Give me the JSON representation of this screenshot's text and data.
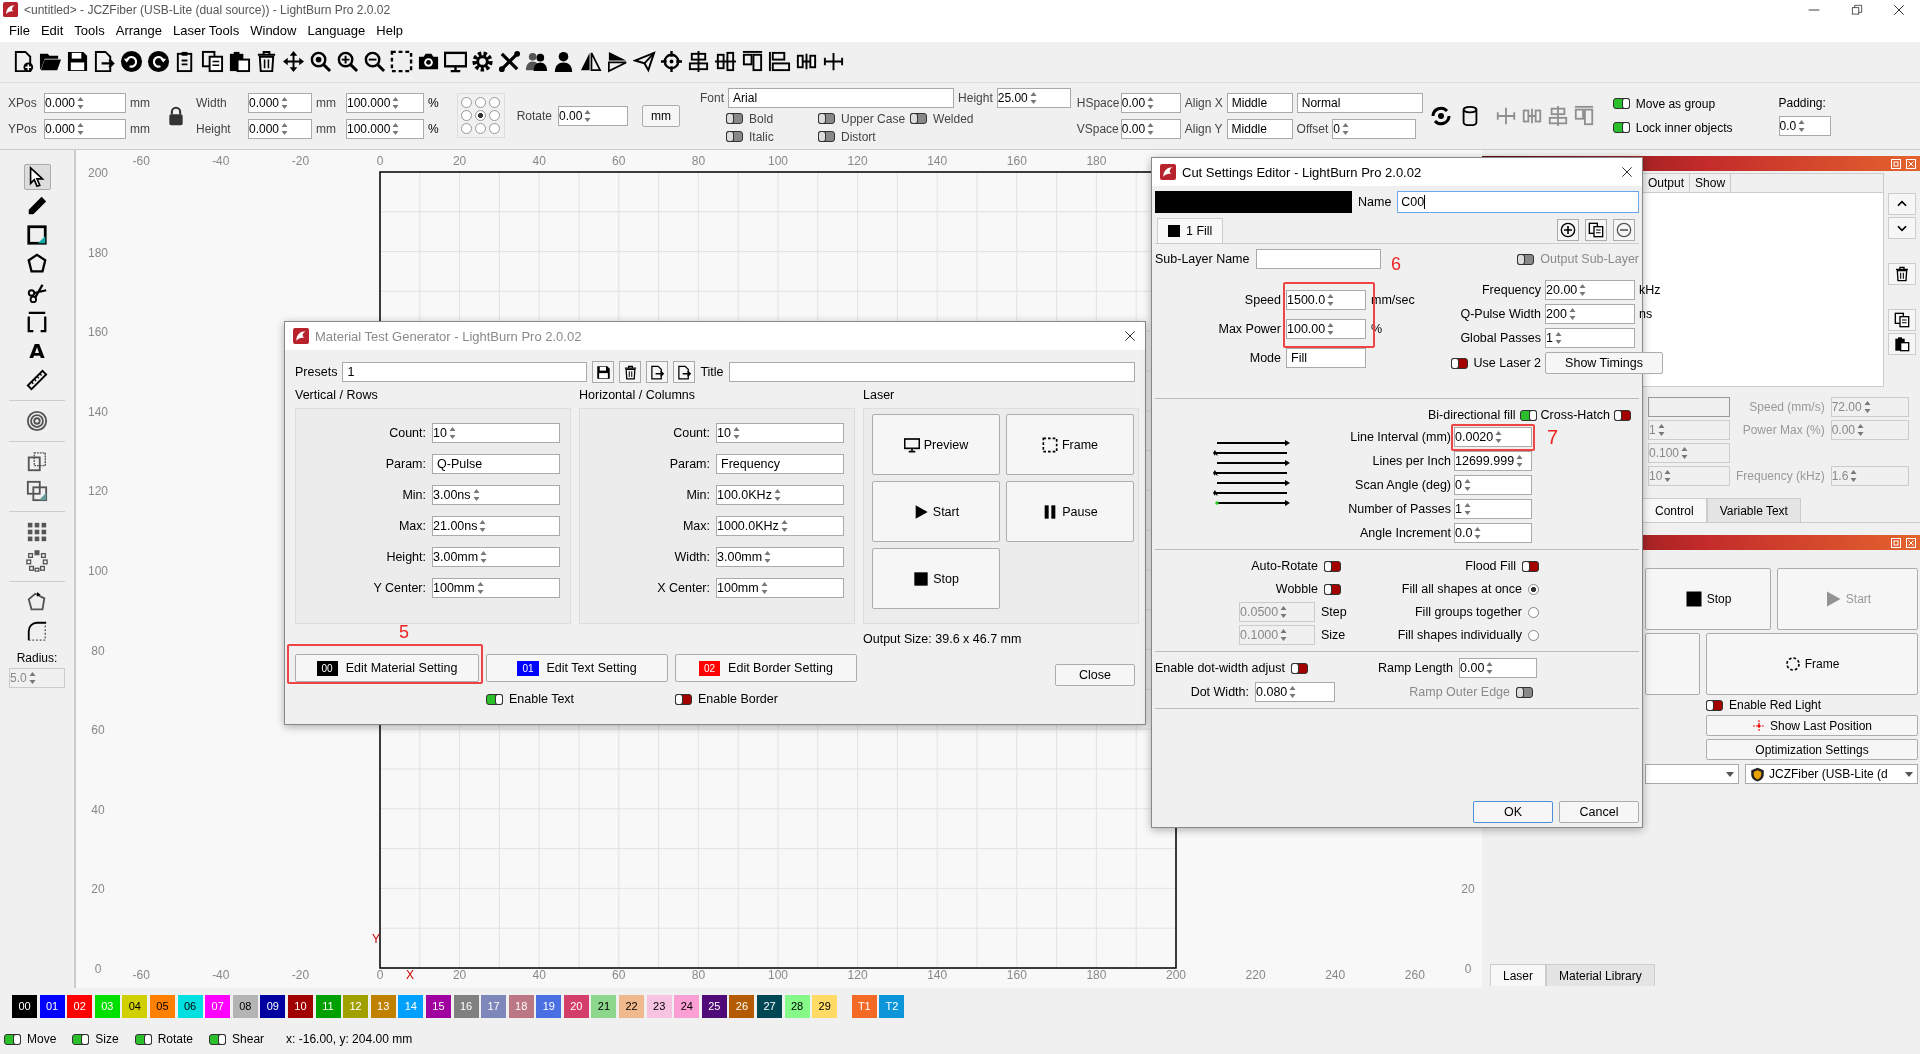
{
  "window": {
    "title": "<untitled> - JCZFiber (USB-Lite (dual source)) - LightBurn Pro 2.0.02"
  },
  "menu": [
    "File",
    "Edit",
    "Tools",
    "Arrange",
    "Laser Tools",
    "Window",
    "Language",
    "Help"
  ],
  "properties": {
    "xpos": {
      "label": "XPos",
      "value": "0.000",
      "unit": "mm"
    },
    "ypos": {
      "label": "YPos",
      "value": "0.000",
      "unit": "mm"
    },
    "width": {
      "label": "Width",
      "value": "0.000",
      "unit": "mm",
      "scale": "100.000",
      "scale_unit": "%"
    },
    "height": {
      "label": "Height",
      "value": "0.000",
      "unit": "mm",
      "scale": "100.000",
      "scale_unit": "%"
    },
    "anchor": [
      {
        "selected": false
      },
      {
        "selected": false
      },
      {
        "selected": false
      },
      {
        "selected": false
      },
      {
        "selected": true
      },
      {
        "selected": false
      },
      {
        "selected": false
      },
      {
        "selected": false
      },
      {
        "selected": false
      }
    ],
    "rotate": {
      "label": "Rotate",
      "value": "0.00"
    },
    "unit_button": "mm",
    "font": {
      "label": "Font",
      "value": "Arial"
    },
    "text_height": {
      "label": "Height",
      "value": "25.00"
    },
    "text_options": [
      {
        "label": "Bold",
        "on": false,
        "disabled": true
      },
      {
        "label": "Upper Case",
        "on": false,
        "disabled": true
      },
      {
        "label": "Welded",
        "on": false,
        "disabled": true
      },
      {
        "label": "Italic",
        "on": false,
        "disabled": true
      },
      {
        "label": "Distort",
        "on": false,
        "disabled": true
      }
    ],
    "hspace": {
      "label": "HSpace",
      "value": "0.00"
    },
    "vspace": {
      "label": "VSpace",
      "value": "0.00"
    },
    "align_x": {
      "label": "Align X",
      "value": "Middle"
    },
    "align_y": {
      "label": "Align Y",
      "value": "Middle"
    },
    "text_mode": "Normal",
    "offset": {
      "label": "Offset",
      "value": "0"
    },
    "group_options": [
      {
        "label": "Move as group",
        "on": true
      },
      {
        "label": "Lock inner objects",
        "on": true
      }
    ],
    "padding": {
      "label": "Padding:",
      "value": "0.0"
    }
  },
  "tools": [
    {
      "selected": true
    },
    {
      "selected": false
    },
    {
      "selected": false
    },
    {
      "selected": false
    },
    {
      "selected": false
    },
    {
      "selected": false
    },
    {
      "selected": false
    },
    {
      "selected": false
    },
    {
      "selected": false
    },
    {
      "selected": false
    },
    {
      "selected": false
    },
    {
      "selected": false
    },
    {
      "selected": false
    },
    {
      "selected": false
    },
    {
      "selected": false
    }
  ],
  "text_tool_glyph": "A",
  "radius": {
    "label": "Radius:",
    "value": "5.0"
  },
  "canvas": {
    "top_ruler": [
      "-60",
      "-40",
      "-20",
      "0",
      "20",
      "40",
      "60",
      "80",
      "100",
      "120",
      "140",
      "160",
      "180"
    ],
    "left_ruler": [
      "200",
      "180",
      "160",
      "140",
      "120",
      "100",
      "80",
      "60",
      "40",
      "20",
      "0"
    ],
    "bottom_ruler": [
      "-60",
      "-40",
      "-20",
      "0",
      "20",
      "40",
      "60",
      "80",
      "100",
      "120",
      "140",
      "160",
      "180",
      "200",
      "220",
      "240",
      "260"
    ],
    "right_ruler": [
      "20",
      "0"
    ],
    "x_axis_label": "X",
    "y_axis_label": "Y"
  },
  "material_test": {
    "title": "Material Test Generator - LightBurn Pro 2.0.02",
    "presets": {
      "label": "Presets",
      "value": "1"
    },
    "title_label": "Title",
    "sections": [
      {
        "heading": "Vertical / Rows",
        "fields": [
          {
            "label": "Count:",
            "value": "10",
            "kind": "spin"
          },
          {
            "label": "Param:",
            "value": "Q-Pulse",
            "kind": "dropdown"
          },
          {
            "label": "Min:",
            "value": "3.00ns",
            "kind": "spin"
          },
          {
            "label": "Max:",
            "value": "21.00ns",
            "kind": "spin"
          },
          {
            "label": "Height:",
            "value": "3.00mm",
            "kind": "spin"
          },
          {
            "label": "Y Center:",
            "value": "100mm",
            "kind": "spin"
          }
        ]
      },
      {
        "heading": "Horizontal / Columns",
        "fields": [
          {
            "label": "Count:",
            "value": "10",
            "kind": "spin"
          },
          {
            "label": "Param:",
            "value": "Frequency",
            "kind": "dropdown"
          },
          {
            "label": "Min:",
            "value": "100.0KHz",
            "kind": "spin"
          },
          {
            "label": "Max:",
            "value": "1000.0KHz",
            "kind": "spin"
          },
          {
            "label": "Width:",
            "value": "3.00mm",
            "kind": "spin"
          },
          {
            "label": "X Center:",
            "value": "100mm",
            "kind": "spin"
          }
        ]
      }
    ],
    "laser_heading": "Laser",
    "laser_buttons": [
      "Preview",
      "Frame",
      "Start",
      "Pause",
      "Stop"
    ],
    "output_size": "Output Size: 39.6 x 46.7 mm",
    "setting_buttons": [
      {
        "swatch": "00",
        "color": "#000000",
        "label": "Edit Material Setting"
      },
      {
        "swatch": "01",
        "color": "#0000ff",
        "label": "Edit Text Setting"
      },
      {
        "swatch": "02",
        "color": "#ff0000",
        "label": "Edit Border Setting"
      }
    ],
    "toggles": [
      {
        "label": "Enable Text",
        "on": true
      },
      {
        "label": "Enable Border",
        "on": false
      }
    ],
    "close_button": "Close",
    "annotation": "5"
  },
  "cut_settings": {
    "title": "Cut Settings Editor - LightBurn Pro 2.0.02",
    "color": "#000000",
    "name": {
      "label": "Name",
      "value": "C00"
    },
    "tabs": [
      {
        "label": "1 Fill",
        "selected": true
      }
    ],
    "sub_layer_name": "Sub-Layer Name",
    "output_sub_layer": {
      "label": "Output Sub-Layer",
      "on": false,
      "disabled": true
    },
    "left_fields": [
      {
        "label": "Speed",
        "value": "1500.0",
        "unit": "mm/sec",
        "kind": "spin"
      },
      {
        "label": "Max Power",
        "value": "100.00",
        "unit": "%",
        "kind": "spin"
      },
      {
        "label": "Mode",
        "value": "Fill",
        "kind": "dropdown"
      }
    ],
    "right_fields": [
      {
        "label": "Frequency",
        "value": "20.00",
        "unit": "kHz"
      },
      {
        "label": "Q-Pulse Width",
        "value": "200",
        "unit": "ns"
      },
      {
        "label": "Global Passes",
        "value": "1"
      }
    ],
    "use_laser_2": {
      "label": "Use Laser 2",
      "on": false
    },
    "show_timings": "Show Timings",
    "bidirectional": {
      "label": "Bi-directional fill",
      "on": true
    },
    "cross_hatch": {
      "label": "Cross-Hatch",
      "on": false
    },
    "fill_fields": [
      {
        "label": "Line Interval (mm)",
        "value": "0.0020"
      },
      {
        "label": "Lines per Inch",
        "value": "12699.999"
      },
      {
        "label": "Scan Angle (deg)",
        "value": "0"
      },
      {
        "label": "Number of Passes",
        "value": "1"
      },
      {
        "label": "Angle Increment",
        "value": "0.0"
      }
    ],
    "auto_rotate": {
      "label": "Auto-Rotate",
      "on": false
    },
    "flood_fill": {
      "label": "Flood Fill",
      "on": false
    },
    "wobble": {
      "label": "Wobble",
      "on": false
    },
    "wobble_fields": [
      {
        "value": "0.0500",
        "label": "Step",
        "disabled": true
      },
      {
        "value": "0.1000",
        "label": "Size",
        "disabled": true
      }
    ],
    "fill_grouping": [
      {
        "label": "Fill all shapes at once",
        "selected": true
      },
      {
        "label": "Fill groups together",
        "selected": false
      },
      {
        "label": "Fill shapes individually",
        "selected": false
      }
    ],
    "dot_width_adjust": {
      "label": "Enable dot-width adjust",
      "on": false
    },
    "dot_width": {
      "label": "Dot Width:",
      "value": "0.080"
    },
    "ramp_length": {
      "label": "Ramp Length",
      "value": "0.00"
    },
    "ramp_outer_edge": {
      "label": "Ramp Outer Edge",
      "on": false,
      "disabled": true
    },
    "buttons": [
      "OK",
      "Cancel"
    ],
    "annotations": [
      "6",
      "7"
    ]
  },
  "layers_panel": {
    "columns": [
      "Output",
      "Show"
    ]
  },
  "quick_settings": {
    "left_values": [
      "1",
      "0.100",
      "10"
    ],
    "rows": [
      {
        "label": "Speed (mm/s)",
        "value": "72.00"
      },
      {
        "label": "Power Max (%)",
        "value": "0.00"
      },
      {
        "label": "Frequency (kHz)",
        "value": "1.6"
      }
    ]
  },
  "panel_tabs": [
    {
      "label": "Control",
      "selected": true
    },
    {
      "label": "Variable Text",
      "selected": false
    }
  ],
  "laser_panel": {
    "stop": "Stop",
    "start": "Start",
    "frame": "Frame",
    "red_light": {
      "label": "Enable Red Light",
      "on": false
    },
    "show_last_position": "Show Last Position",
    "optimization": "Optimization Settings",
    "device": "JCZFiber (USB-Lite (d"
  },
  "bottom_tabs": [
    {
      "label": "Laser",
      "selected": true
    },
    {
      "label": "Material Library",
      "selected": false
    }
  ],
  "palette": [
    {
      "label": "00",
      "color": "#000000"
    },
    {
      "label": "01",
      "color": "#0000ff"
    },
    {
      "label": "02",
      "color": "#ff0000"
    },
    {
      "label": "03",
      "color": "#00e000"
    },
    {
      "label": "04",
      "color": "#d0d000"
    },
    {
      "label": "05",
      "color": "#ff8000"
    },
    {
      "label": "06",
      "color": "#00e0e0"
    },
    {
      "label": "07",
      "color": "#ff00ff"
    },
    {
      "label": "08",
      "color": "#b4b4b4"
    },
    {
      "label": "09",
      "color": "#0000a0"
    },
    {
      "label": "10",
      "color": "#a00000"
    },
    {
      "label": "11",
      "color": "#00a000"
    },
    {
      "label": "12",
      "color": "#a0a000"
    },
    {
      "label": "13",
      "color": "#c08000"
    },
    {
      "label": "14",
      "color": "#00a0ff"
    },
    {
      "label": "15",
      "color": "#a000a0"
    },
    {
      "label": "16",
      "color": "#808080"
    },
    {
      "label": "17",
      "color": "#7d87b9"
    },
    {
      "label": "18",
      "color": "#bb7784"
    },
    {
      "label": "19",
      "color": "#4a6fe3"
    },
    {
      "label": "20",
      "color": "#d33f6a"
    },
    {
      "label": "21",
      "color": "#8cd78c"
    },
    {
      "label": "22",
      "color": "#f0b98d"
    },
    {
      "label": "23",
      "color": "#f6c4e1"
    },
    {
      "label": "24",
      "color": "#fa9ed4"
    },
    {
      "label": "25",
      "color": "#500a78"
    },
    {
      "label": "26",
      "color": "#b45a00"
    },
    {
      "label": "27",
      "color": "#004754"
    },
    {
      "label": "28",
      "color": "#86fa88"
    },
    {
      "label": "29",
      "color": "#ffdb66"
    },
    {
      "label": "T1",
      "color": "#f36926"
    },
    {
      "label": "T2",
      "color": "#0c96d9"
    }
  ],
  "status": {
    "toggles": [
      {
        "label": "Move",
        "on": true
      },
      {
        "label": "Size",
        "on": true
      },
      {
        "label": "Rotate",
        "on": true
      },
      {
        "label": "Shear",
        "on": true
      }
    ],
    "coords": "x: -16.00, y: 204.00 mm"
  }
}
